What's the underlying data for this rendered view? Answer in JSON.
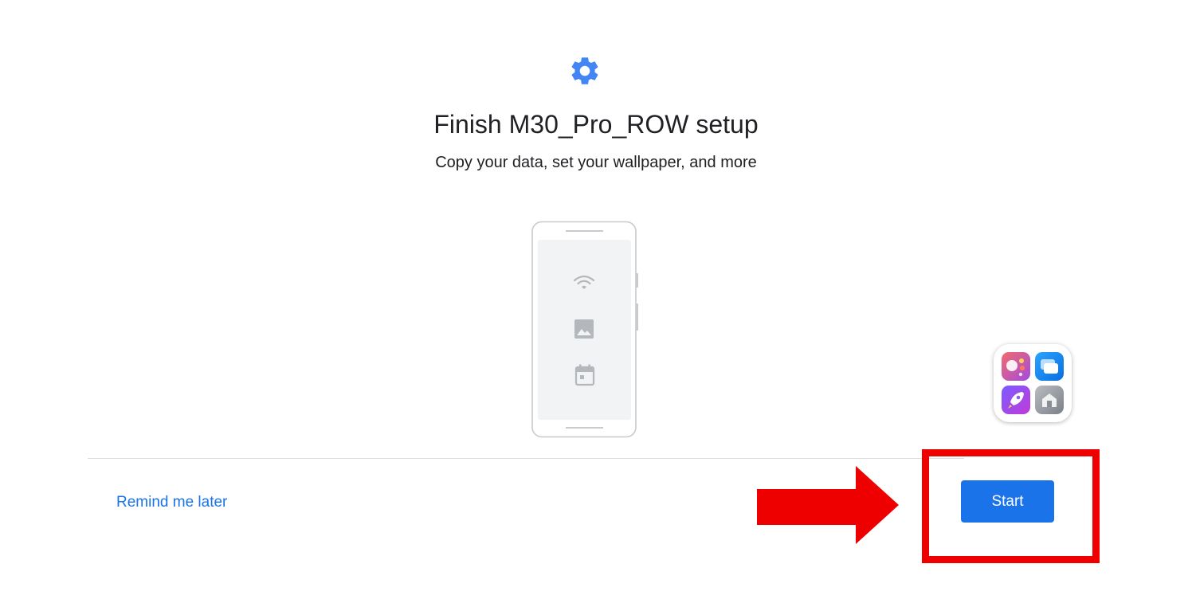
{
  "header": {
    "icon": "gear-icon",
    "accent_color": "#4285f4"
  },
  "title": "Finish M30_Pro_ROW setup",
  "subtitle": "Copy your data, set your wallpaper, and more",
  "illustration": {
    "items": [
      "wifi-icon",
      "image-icon",
      "calendar-icon"
    ]
  },
  "launcher": {
    "tiles": [
      "assistant-app-icon",
      "cards-app-icon",
      "rocket-app-icon",
      "home-app-icon"
    ]
  },
  "footer": {
    "remind_label": "Remind me later",
    "start_label": "Start",
    "link_color": "#1a73e8",
    "button_color": "#1a73e8"
  },
  "annotation": {
    "arrow_color": "#ee0000",
    "box_color": "#ee0000"
  }
}
